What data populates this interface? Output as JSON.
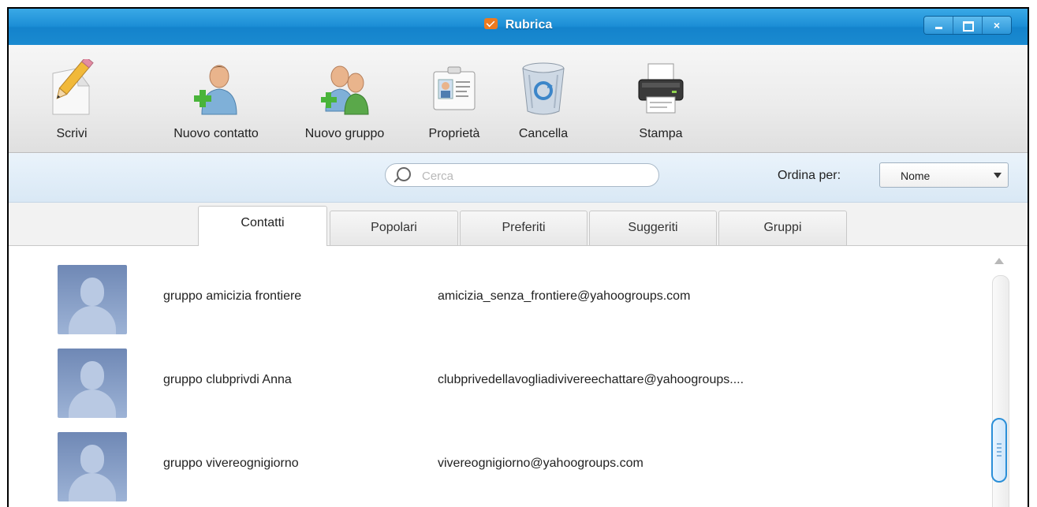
{
  "window": {
    "title": "Rubrica",
    "close_glyph": "×"
  },
  "toolbar": {
    "items": [
      {
        "label": "Scrivi",
        "icon": "pencil-icon"
      },
      {
        "label": "Nuovo contatto",
        "icon": "add-contact-icon"
      },
      {
        "label": "Nuovo gruppo",
        "icon": "add-group-icon"
      },
      {
        "label": "Proprietà",
        "icon": "contact-card-icon"
      },
      {
        "label": "Cancella",
        "icon": "recycle-bin-icon"
      },
      {
        "label": "Stampa",
        "icon": "printer-icon"
      }
    ]
  },
  "search": {
    "placeholder": "Cerca",
    "value": ""
  },
  "sort": {
    "label": "Ordina per:",
    "selected": "Nome"
  },
  "tabs": [
    {
      "label": "Contatti",
      "active": true
    },
    {
      "label": "Popolari",
      "active": false
    },
    {
      "label": "Preferiti",
      "active": false
    },
    {
      "label": "Suggeriti",
      "active": false
    },
    {
      "label": "Gruppi",
      "active": false
    }
  ],
  "contacts": [
    {
      "name": "gruppo amicizia frontiere",
      "email": "amicizia_senza_frontiere@yahoogroups.com"
    },
    {
      "name": "gruppo clubprivdi Anna",
      "email": "clubprivedellavogliadivivereechattare@yahoogroups...."
    },
    {
      "name": "gruppo vivereognigiorno",
      "email": "vivereognigiorno@yahoogroups.com"
    }
  ],
  "colors": {
    "titlebar": "#1c8ed6",
    "accent": "#2b8fd8",
    "avatar": "#7d93bd"
  }
}
